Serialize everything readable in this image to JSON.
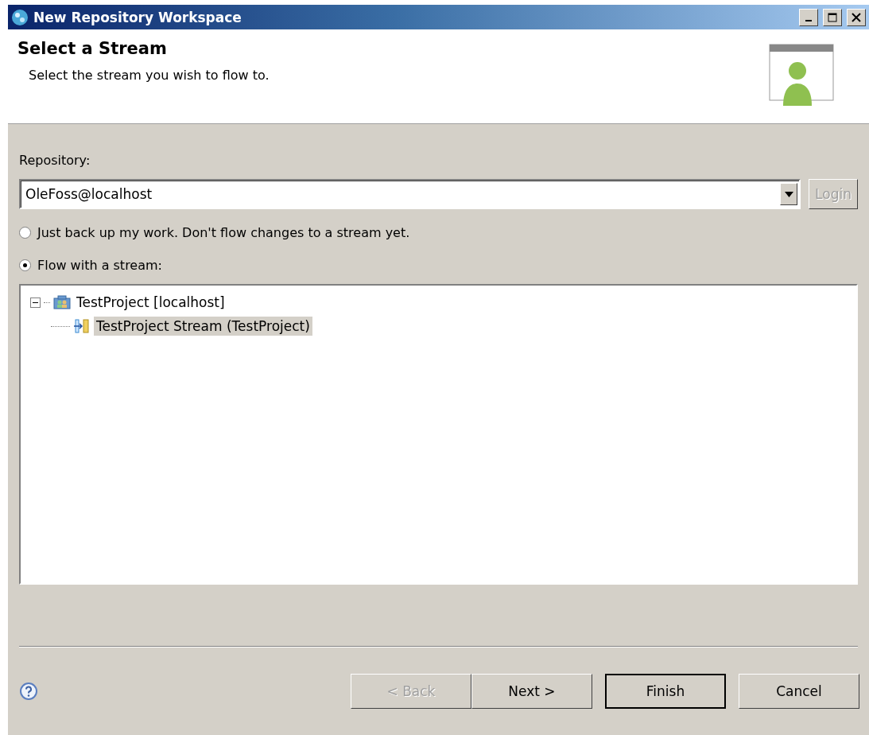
{
  "window": {
    "title": "New Repository Workspace"
  },
  "header": {
    "title": "Select a Stream",
    "description": "Select the stream you wish to flow to."
  },
  "repository": {
    "label": "Repository:",
    "value": "OleFoss@localhost",
    "login_button": {
      "label": "Login",
      "disabled": true
    }
  },
  "options": [
    {
      "label": "Just back up my work. Don't flow changes to a stream yet.",
      "selected": false
    },
    {
      "label": "Flow with a stream:",
      "selected": true
    }
  ],
  "tree": [
    {
      "label": "TestProject [localhost]",
      "kind": "project",
      "expanded": true,
      "selected": false,
      "children": [
        {
          "label": "TestProject Stream (TestProject)",
          "kind": "stream",
          "selected": true
        }
      ]
    }
  ],
  "buttons": [
    {
      "label": "< Back",
      "disabled": true,
      "default": false
    },
    {
      "label": "Next >",
      "disabled": false,
      "default": false
    },
    {
      "label": "Finish",
      "disabled": false,
      "default": true
    },
    {
      "label": "Cancel",
      "disabled": false,
      "default": false
    }
  ]
}
